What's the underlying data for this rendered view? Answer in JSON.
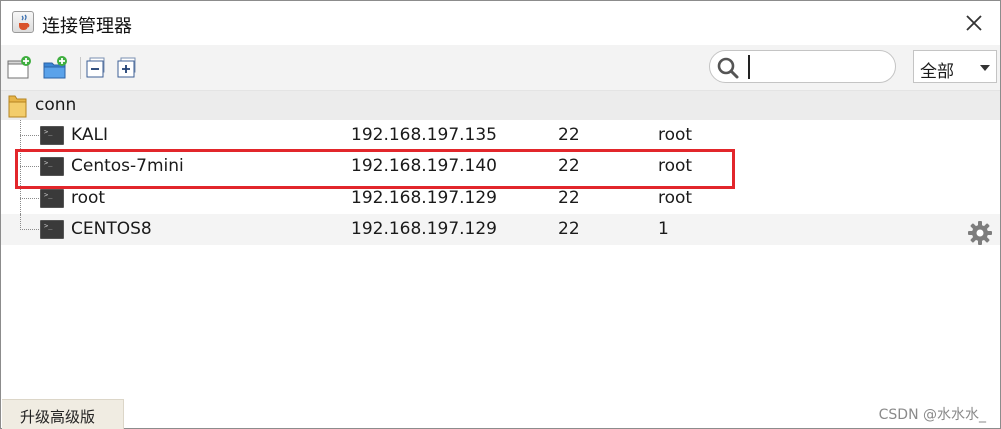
{
  "window": {
    "title": "连接管理器",
    "icons": {
      "app": "java-cup-icon",
      "close": "close-icon"
    }
  },
  "toolbar": {
    "buttons": [
      {
        "name": "new-connection-icon"
      },
      {
        "name": "new-folder-icon"
      },
      {
        "name": "collapse-all-icon"
      },
      {
        "name": "expand-all-icon"
      }
    ],
    "search": {
      "value": "",
      "placeholder": "",
      "icon": "search-icon"
    },
    "filter": {
      "selected": "全部"
    }
  },
  "tree": {
    "group": {
      "label": "conn",
      "icon": "folder-icon"
    },
    "rows": [
      {
        "name": "KALI",
        "host": "192.168.197.135",
        "port": "22",
        "user": "root"
      },
      {
        "name": "Centos-7mini",
        "host": "192.168.197.140",
        "port": "22",
        "user": "root"
      },
      {
        "name": "root",
        "host": "192.168.197.129",
        "port": "22",
        "user": "root"
      },
      {
        "name": "CENTOS8",
        "host": "192.168.197.129",
        "port": "22",
        "user": "1"
      }
    ],
    "row_icon": "terminal-icon",
    "prompt_glyph": ">_"
  },
  "footer": {
    "upgrade_label": "升级高级版",
    "watermark": "CSDN @水水水_"
  },
  "colors": {
    "highlight": "#e2262b",
    "toolbar_bg": "#f3f3f3",
    "group_bg": "#ececec",
    "alt_row_bg": "#f4f4f4"
  }
}
